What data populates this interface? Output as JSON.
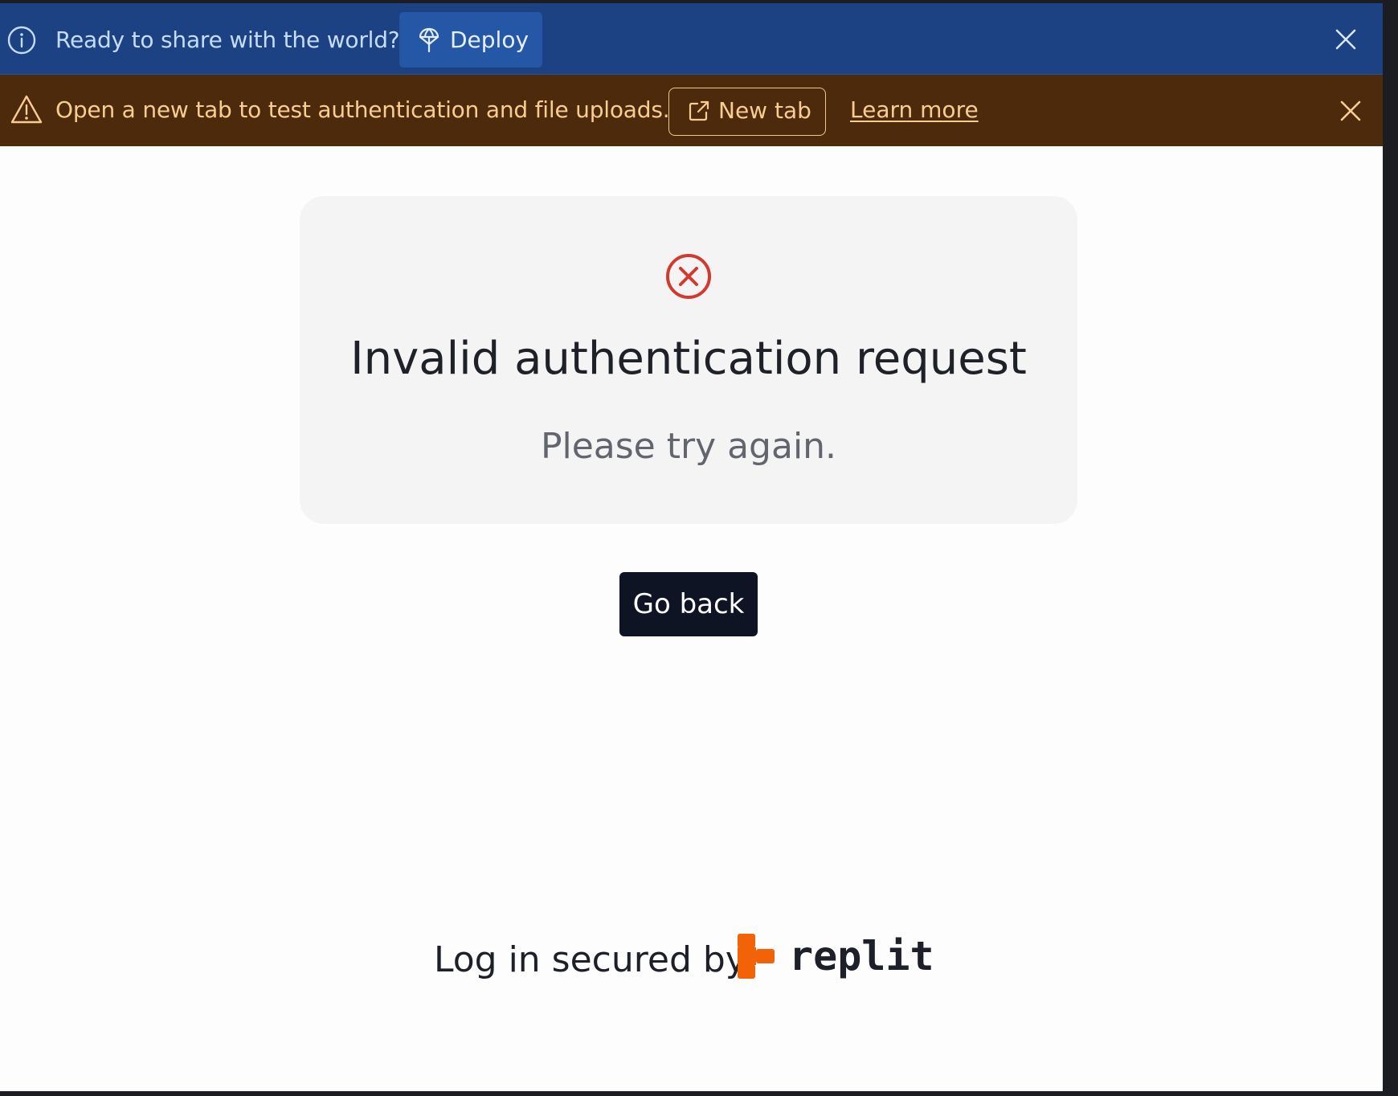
{
  "deploy_banner": {
    "text": "Ready to share with the world?",
    "button_label": "Deploy",
    "background": "#1c4283",
    "icons": [
      "info-icon",
      "deploy-pin-icon",
      "close-icon"
    ]
  },
  "warning_banner": {
    "text": "Open a new tab to test authentication and file uploads.",
    "new_tab_label": "New tab",
    "learn_more_label": "Learn more",
    "background": "#4e2a0d",
    "icons": [
      "warning-icon",
      "external-link-icon",
      "close-icon"
    ]
  },
  "error": {
    "title": "Invalid authentication request",
    "message": "Please try again.",
    "icon": "error-circle-x-icon",
    "icon_color": "#d23a2f"
  },
  "actions": {
    "go_back_label": "Go back"
  },
  "footer": {
    "text": "Log in secured by",
    "brand_name": "replit",
    "brand_color": "#f26207"
  }
}
